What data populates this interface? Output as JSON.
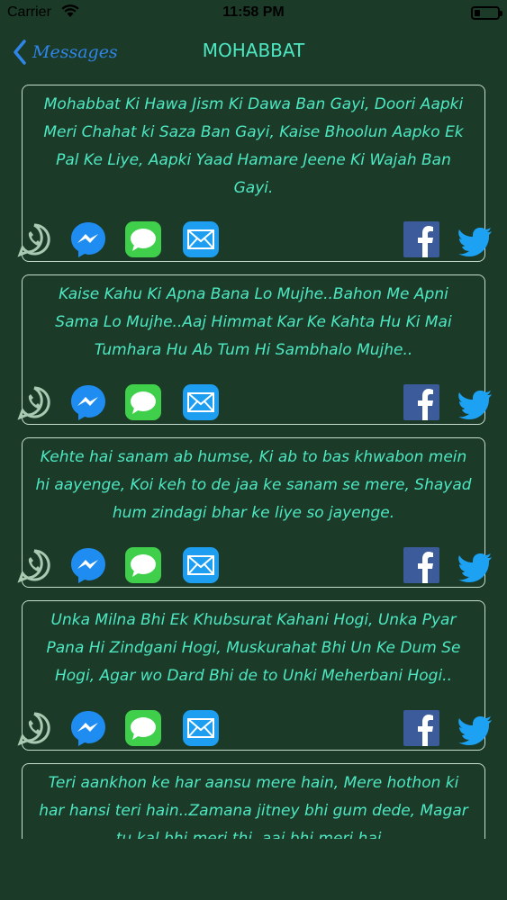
{
  "status": {
    "carrier": "Carrier",
    "time": "11:58 PM"
  },
  "nav": {
    "back_label": "Messages",
    "title": "MOHABBAT"
  },
  "colors": {
    "background": "#1c3a28",
    "accent_text": "#4de8c2",
    "back_link": "#2e86e8",
    "card_border": "#c6ddd0"
  },
  "share_icons": [
    "whatsapp-icon",
    "messenger-icon",
    "message-icon",
    "mail-icon",
    "facebook-icon",
    "twitter-icon"
  ],
  "messages": [
    {
      "text": "Mohabbat Ki Hawa Jism Ki Dawa Ban Gayi, Doori Aapki Meri Chahat ki Saza Ban Gayi, Kaise Bhoolun Aapko Ek Pal Ke Liye, Aapki Yaad Hamare Jeene Ki Wajah Ban Gayi."
    },
    {
      "text": "Kaise Kahu Ki Apna Bana Lo Mujhe..Bahon Me Apni Sama Lo Mujhe..Aaj Himmat Kar Ke Kahta Hu Ki  Mai Tumhara Hu Ab Tum Hi Sambhalo Mujhe.."
    },
    {
      "text": "Kehte hai sanam ab humse, Ki ab to bas khwabon mein hi aayenge, Koi keh to de jaa ke sanam se mere, Shayad hum zindagi bhar ke liye so jayenge."
    },
    {
      "text": "Unka Milna Bhi Ek Khubsurat Kahani Hogi, Unka Pyar Pana Hi Zindgani Hogi, Muskurahat Bhi Un Ke Dum Se Hogi, Agar wo Dard Bhi de to Unki Meherbani Hogi.."
    },
    {
      "text": "Teri aankhon ke har aansu mere hain, Mere hothon ki har hansi teri hain..Zamana jitney bhi gum dede, Magar tu kal bhi meri thi, aaj bhi meri hai.."
    }
  ]
}
